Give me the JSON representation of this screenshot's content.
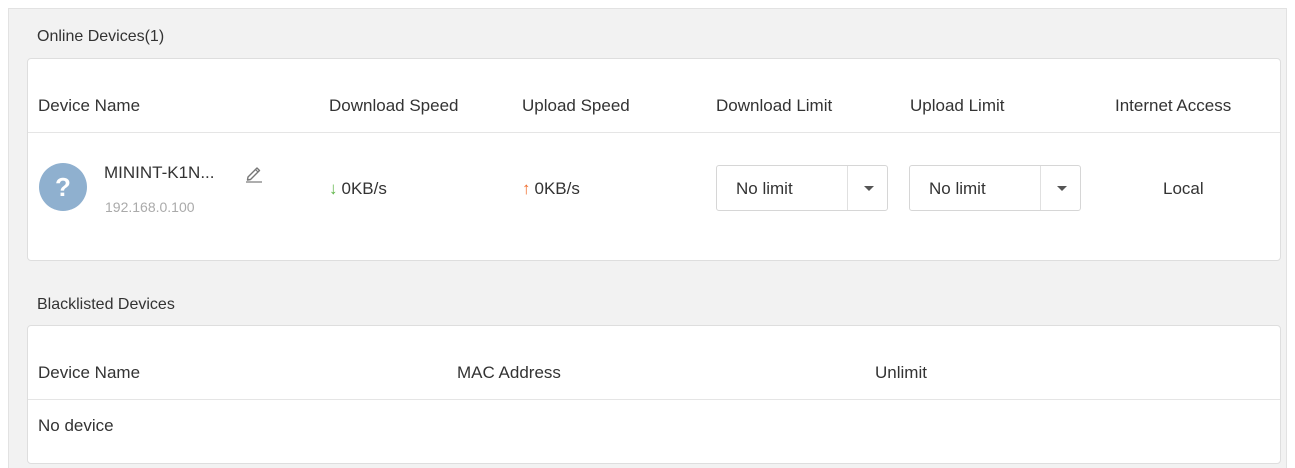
{
  "online": {
    "title": "Online Devices(1)",
    "columns": {
      "device_name": "Device Name",
      "download_speed": "Download Speed",
      "upload_speed": "Upload Speed",
      "download_limit": "Download Limit",
      "upload_limit": "Upload Limit",
      "internet_access": "Internet Access"
    },
    "devices": [
      {
        "avatar_symbol": "?",
        "name": "MININT-K1N...",
        "ip": "192.168.0.100",
        "download_arrow": "↓",
        "download_speed": "0KB/s",
        "upload_arrow": "↑",
        "upload_speed": "0KB/s",
        "download_limit": "No limit",
        "upload_limit": "No limit",
        "internet_access": "Local"
      }
    ]
  },
  "blacklist": {
    "title": "Blacklisted Devices",
    "columns": {
      "device_name": "Device Name",
      "mac_address": "MAC Address",
      "unlimit": "Unlimit"
    },
    "empty_text": "No device"
  },
  "icons": {
    "avatar": "unknown-device-icon",
    "edit": "pencil-icon",
    "dropdown": "caret-down-icon"
  },
  "colors": {
    "download_arrow": "#5fb548",
    "upload_arrow": "#f06c2c",
    "avatar_bg": "#8fb0cf"
  }
}
